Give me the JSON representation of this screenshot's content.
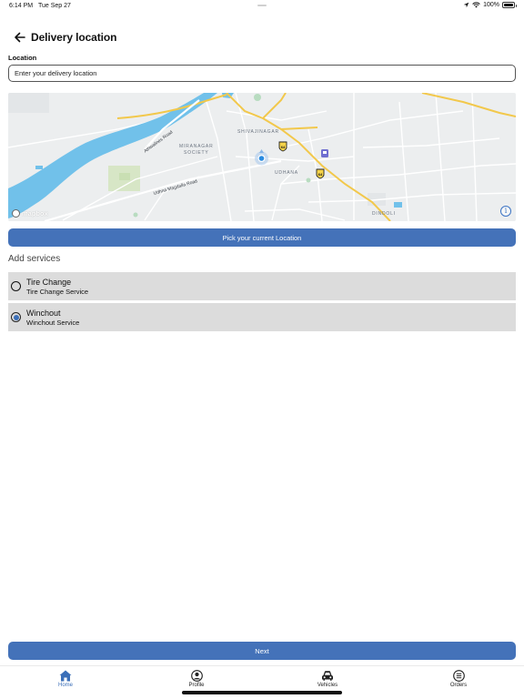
{
  "status_bar": {
    "time": "6:14 PM",
    "date": "Tue Sep 27",
    "battery": "100%",
    "battery_level": 1.0,
    "icons": [
      "location-arrow-icon",
      "wifi-icon",
      "battery-icon"
    ]
  },
  "header": {
    "title": "Delivery location",
    "back_icon": "arrow-left-icon"
  },
  "location": {
    "label": "Location",
    "placeholder": "Enter your delivery location",
    "value": ""
  },
  "map": {
    "labels": {
      "shivajinagar": "SHIVAJINAGAR",
      "miranagar": "MIRANAGAR",
      "society": "SOCIETY",
      "udhana": "UDHANA",
      "dindoli": "DINDOLI"
    },
    "roads": {
      "athwalines": "Athwalines Road",
      "udhna_magdalla": "Udhna Magdalla Road"
    },
    "shield_numbers": [
      "64",
      "64"
    ],
    "attribution": "mapbox",
    "info_icon": "info-icon"
  },
  "buttons": {
    "pick_location": "Pick your current Location",
    "next": "Next"
  },
  "services": {
    "title": "Add services",
    "items": [
      {
        "name": "Tire Change",
        "description": "Tire Change Service",
        "selected": false
      },
      {
        "name": "Winchout",
        "description": "Winchout Service",
        "selected": true
      }
    ]
  },
  "tabs": [
    {
      "label": "Home",
      "icon": "home-icon",
      "active": true
    },
    {
      "label": "Profile",
      "icon": "profile-icon",
      "active": false
    },
    {
      "label": "Vehicles",
      "icon": "car-icon",
      "active": false
    },
    {
      "label": "Orders",
      "icon": "orders-icon",
      "active": false
    }
  ],
  "colors": {
    "primary": "#4472b9",
    "active_tab": "#3b6fb8",
    "river": "#71c1ea",
    "major_road": "#f2c84b",
    "service_bg": "#dcdcdc"
  }
}
